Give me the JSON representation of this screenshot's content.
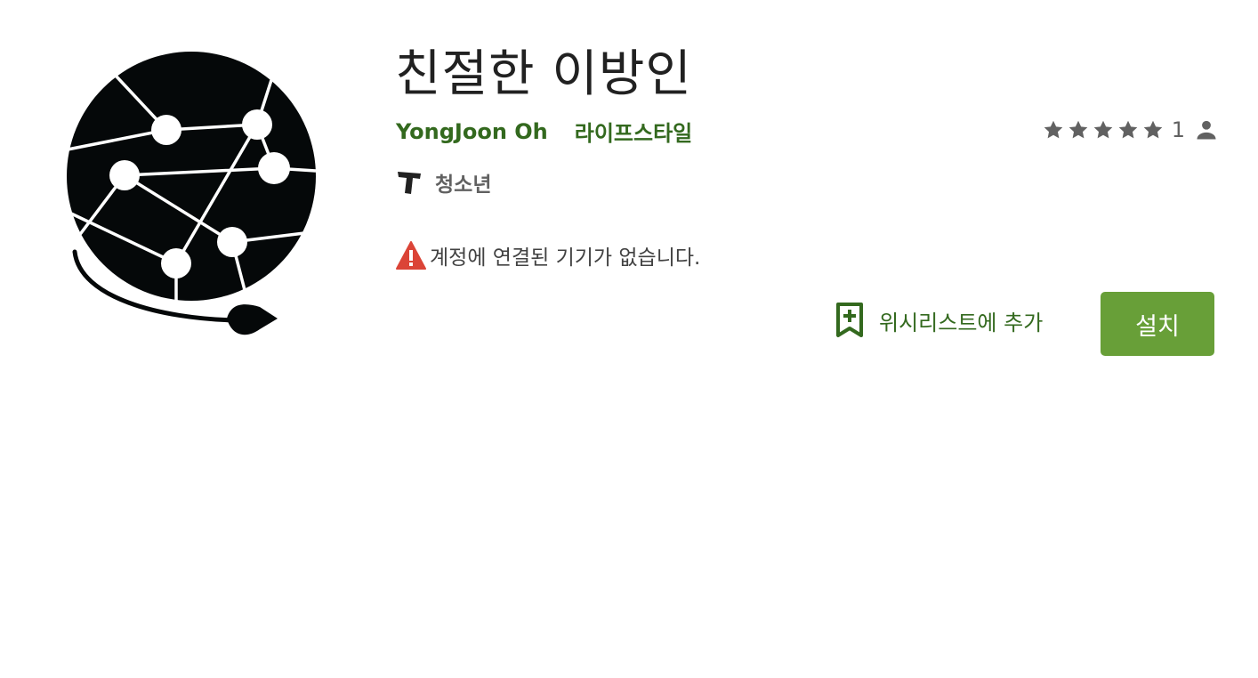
{
  "app": {
    "title": "친절한 이방인",
    "developer": "YongJoon Oh",
    "category": "라이프스타일"
  },
  "rating": {
    "stars": 5,
    "count": "1"
  },
  "content_rating": {
    "label": "청소년"
  },
  "warning": {
    "text": "계정에 연결된 기기가 없습니다."
  },
  "actions": {
    "wishlist_label": "위시리스트에 추가",
    "install_label": "설치"
  },
  "colors": {
    "accent_green": "#33691e",
    "install_green": "#689f38",
    "warning_red": "#db4437"
  },
  "icons": [
    "app-logo-globe",
    "star-icon",
    "person-icon",
    "teen-rating-icon",
    "warning-icon",
    "bookmark-add-icon"
  ]
}
